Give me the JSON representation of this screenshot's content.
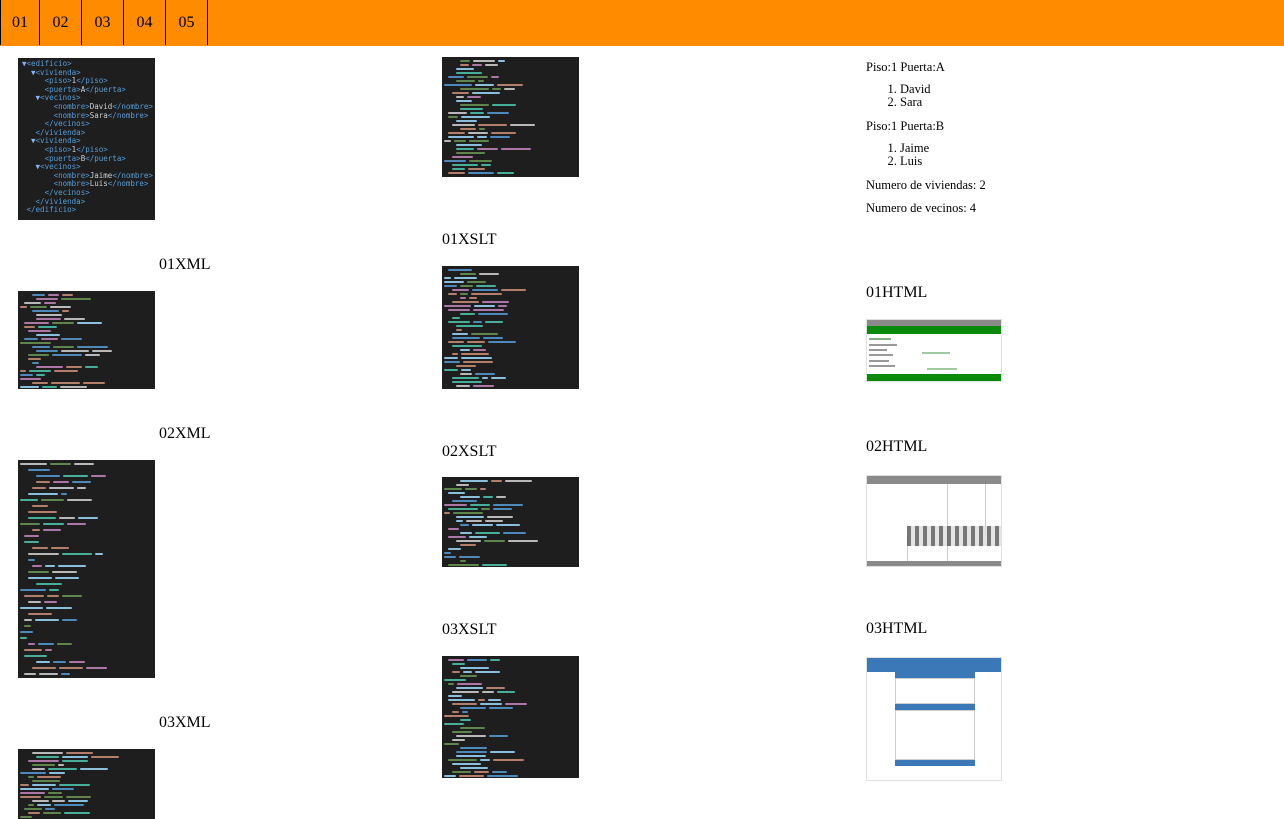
{
  "nav": {
    "tabs": [
      "01",
      "02",
      "03",
      "04",
      "05"
    ]
  },
  "captions": {
    "xml": [
      "01XML",
      "02XML",
      "03XML"
    ],
    "xslt": [
      "01XSLT",
      "02XSLT",
      "03XSLT"
    ],
    "html": [
      "01HTML",
      "02HTML",
      "03HTML"
    ]
  },
  "xml01_lines": [
    "▼<edificio>",
    "  ▼<vivienda>",
    "     <piso>1</piso>",
    "     <puerta>A</puerta>",
    "   ▼<vecinos>",
    "       <nombre>David</nombre>",
    "       <nombre>Sara</nombre>",
    "     </vecinos>",
    "   </vivienda>",
    "  ▼<vivienda>",
    "     <piso>1</piso>",
    "     <puerta>B</puerta>",
    "   ▼<vecinos>",
    "       <nombre>Jaime</nombre>",
    "       <nombre>Luis</nombre>",
    "     </vecinos>",
    "   </vivienda>",
    " </edificio>"
  ],
  "preview": {
    "block1_title": "Piso:1 Puerta:A",
    "block1_items": [
      "David",
      "Sara"
    ],
    "block2_title": "Piso:1 Puerta:B",
    "block2_items": [
      "Jaime",
      "Luis"
    ],
    "viviendas": "Numero de viviendas: 2",
    "vecinos": "Numero de vecinos: 4"
  }
}
